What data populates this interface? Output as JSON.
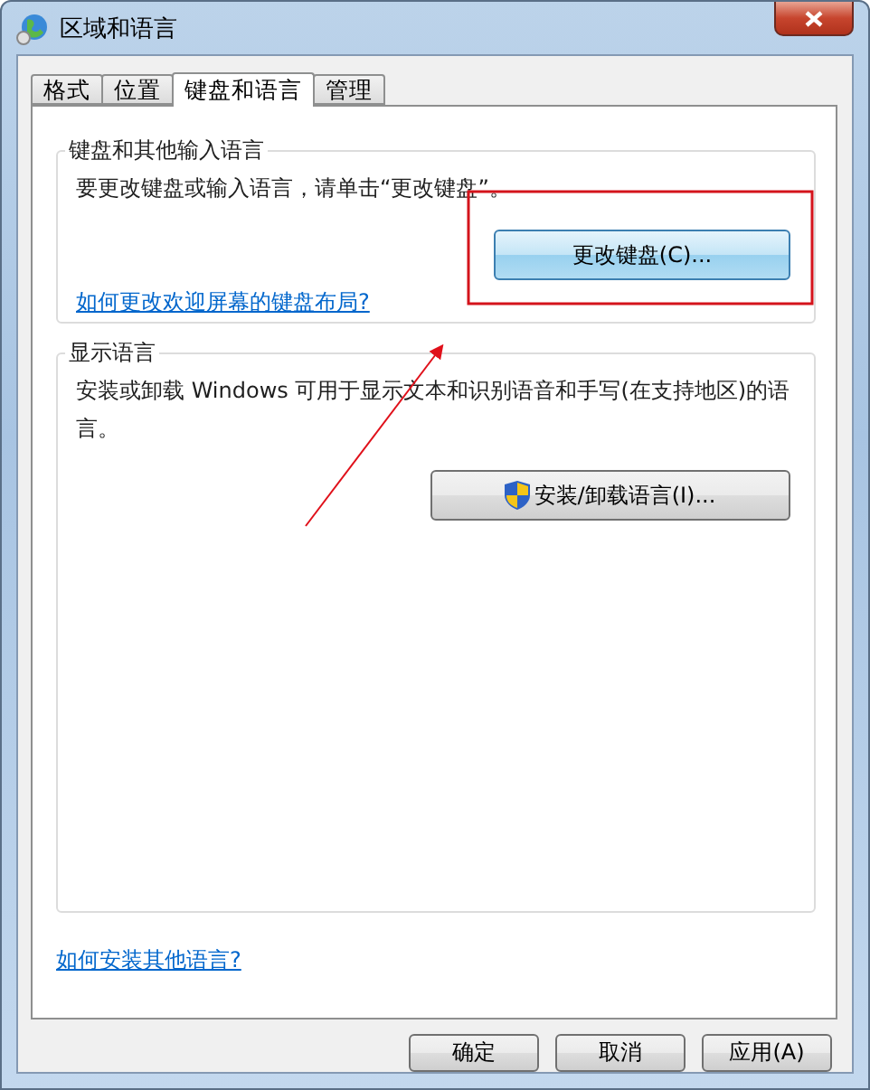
{
  "window": {
    "title": "区域和语言"
  },
  "tabs": [
    {
      "label": "格式",
      "selected": false
    },
    {
      "label": "位置",
      "selected": false
    },
    {
      "label": "键盘和语言",
      "selected": true
    },
    {
      "label": "管理",
      "selected": false
    }
  ],
  "groups": [
    {
      "title": "键盘和其他输入语言",
      "description": "要更改键盘或输入语言，请单击“更改键盘”。",
      "button": {
        "label": "更改键盘(C)...",
        "shield": false,
        "focused": true
      },
      "link": "如何更改欢迎屏幕的键盘布局?"
    },
    {
      "title": "显示语言",
      "description": "安装或卸载 Windows 可用于显示文本和识别语音和手写(在支持地区)的语言。",
      "button": {
        "label": "安装/卸载语言(I)...",
        "shield": true,
        "focused": false
      }
    }
  ],
  "help_link": "如何安装其他语言?",
  "buttons": [
    "确定",
    "取消",
    "应用(A)"
  ]
}
